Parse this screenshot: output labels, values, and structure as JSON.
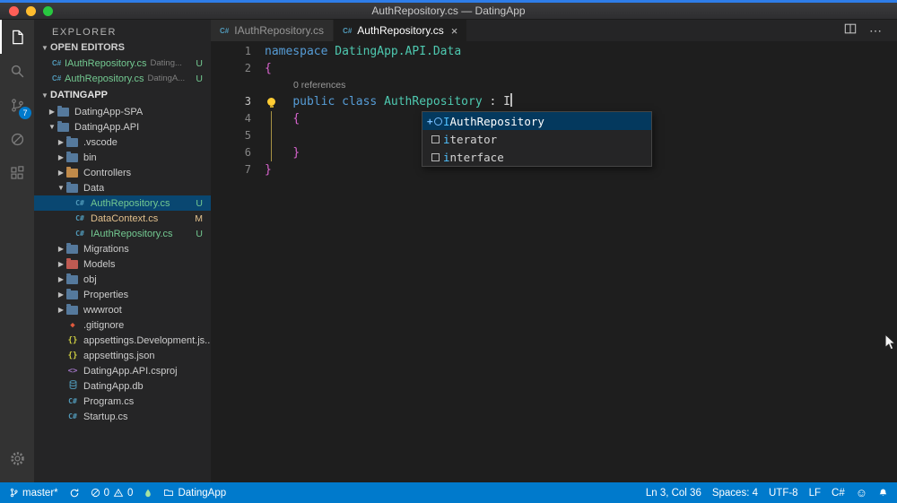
{
  "window": {
    "title": "AuthRepository.cs — DatingApp"
  },
  "activity_bar": {
    "items": [
      "explorer",
      "search",
      "source-control",
      "debug",
      "extensions"
    ],
    "scm_badge": "7",
    "bottom": [
      "settings"
    ]
  },
  "sidebar": {
    "title": "EXPLORER",
    "open_editors": {
      "label": "OPEN EDITORS",
      "items": [
        {
          "name": "IAuthRepository.cs",
          "detail": "Dating...",
          "badge": "U"
        },
        {
          "name": "AuthRepository.cs",
          "detail": "DatingA...",
          "badge": "U"
        }
      ]
    },
    "root": "DATINGAPP",
    "tree": [
      {
        "name": "DatingApp-SPA",
        "kind": "folder",
        "indent": 1,
        "expanded": false
      },
      {
        "name": "DatingApp.API",
        "kind": "folder",
        "indent": 1,
        "expanded": true
      },
      {
        "name": ".vscode",
        "kind": "folder",
        "indent": 2,
        "expanded": false
      },
      {
        "name": "bin",
        "kind": "folder",
        "indent": 2,
        "expanded": false
      },
      {
        "name": "Controllers",
        "kind": "folder",
        "indent": 2,
        "expanded": false,
        "icon_color": "#c08a4a"
      },
      {
        "name": "Data",
        "kind": "folder",
        "indent": 2,
        "expanded": true
      },
      {
        "name": "AuthRepository.cs",
        "kind": "file",
        "icon": "csharp",
        "indent": 3,
        "badge": "U",
        "git": "untracked",
        "selected": true
      },
      {
        "name": "DataContext.cs",
        "kind": "file",
        "icon": "csharp",
        "indent": 3,
        "badge": "M",
        "git": "modified"
      },
      {
        "name": "IAuthRepository.cs",
        "kind": "file",
        "icon": "csharp",
        "indent": 3,
        "badge": "U",
        "git": "untracked"
      },
      {
        "name": "Migrations",
        "kind": "folder",
        "indent": 2,
        "expanded": false
      },
      {
        "name": "Models",
        "kind": "folder",
        "indent": 2,
        "expanded": false,
        "icon_color": "#bf5a52"
      },
      {
        "name": "obj",
        "kind": "folder",
        "indent": 2,
        "expanded": false
      },
      {
        "name": "Properties",
        "kind": "folder",
        "indent": 2,
        "expanded": false
      },
      {
        "name": "wwwroot",
        "kind": "folder",
        "indent": 2,
        "expanded": false
      },
      {
        "name": ".gitignore",
        "kind": "file",
        "icon": "git",
        "indent": 2
      },
      {
        "name": "appsettings.Development.js...",
        "kind": "file",
        "icon": "json",
        "indent": 2
      },
      {
        "name": "appsettings.json",
        "kind": "file",
        "icon": "json",
        "indent": 2
      },
      {
        "name": "DatingApp.API.csproj",
        "kind": "file",
        "icon": "xml",
        "indent": 2
      },
      {
        "name": "DatingApp.db",
        "kind": "file",
        "icon": "database",
        "indent": 2
      },
      {
        "name": "Program.cs",
        "kind": "file",
        "icon": "csharp",
        "indent": 2
      },
      {
        "name": "Startup.cs",
        "kind": "file",
        "icon": "csharp",
        "indent": 2
      }
    ]
  },
  "editor": {
    "tabs": [
      {
        "label": "IAuthRepository.cs",
        "active": false
      },
      {
        "label": "AuthRepository.cs",
        "active": true,
        "close": "×"
      }
    ],
    "action_icons": [
      "split-editor",
      "more-actions"
    ],
    "lines": [
      {
        "num": "1",
        "tokens": [
          [
            "namespace",
            "kw"
          ],
          [
            " ",
            "pl"
          ],
          [
            "DatingApp.API.Data",
            "ty"
          ]
        ]
      },
      {
        "num": "2",
        "tokens": [
          [
            "{",
            "br"
          ]
        ]
      },
      {
        "type": "codelens",
        "text": "0 references"
      },
      {
        "num": "3",
        "active": true,
        "lightbulb": true,
        "cursor": true,
        "tokens": [
          [
            "    ",
            "pl"
          ],
          [
            "public",
            "kw"
          ],
          [
            " ",
            "pl"
          ],
          [
            "class",
            "kw"
          ],
          [
            " ",
            "pl"
          ],
          [
            "AuthRepository",
            "ty"
          ],
          [
            " : ",
            "pl"
          ],
          [
            "I",
            "pl"
          ]
        ]
      },
      {
        "num": "4",
        "tokens": [
          [
            "    ",
            "pl"
          ],
          [
            "{",
            "br"
          ]
        ]
      },
      {
        "num": "5",
        "tokens": []
      },
      {
        "num": "6",
        "tokens": [
          [
            "    ",
            "pl"
          ],
          [
            "}",
            "br"
          ]
        ]
      },
      {
        "num": "7",
        "tokens": [
          [
            "}",
            "br"
          ]
        ]
      }
    ],
    "suggest": {
      "items": [
        {
          "icon": "interface",
          "label": "IAuthRepository",
          "match": "I",
          "selected": true
        },
        {
          "icon": "keyword",
          "label": "iterator",
          "match": "i"
        },
        {
          "icon": "keyword",
          "label": "interface",
          "match": "i"
        }
      ]
    }
  },
  "status_bar": {
    "branch": "master*",
    "errors": "0",
    "warnings": "0",
    "project": "DatingApp",
    "line_col": "Ln 3, Col 36",
    "spaces": "Spaces: 4",
    "encoding": "UTF-8",
    "eol": "LF",
    "language": "C#",
    "left_icons": [
      "git-branch",
      "sync",
      "error",
      "warning",
      "flame",
      "folder"
    ],
    "right_icons": [
      "smiley",
      "bell"
    ]
  },
  "colors": {
    "accent": "#007acc",
    "untracked": "#73c991",
    "modified": "#e2c08d",
    "keyword": "#569cd6",
    "type": "#4ec9b0",
    "bracket": "#d964cf"
  }
}
